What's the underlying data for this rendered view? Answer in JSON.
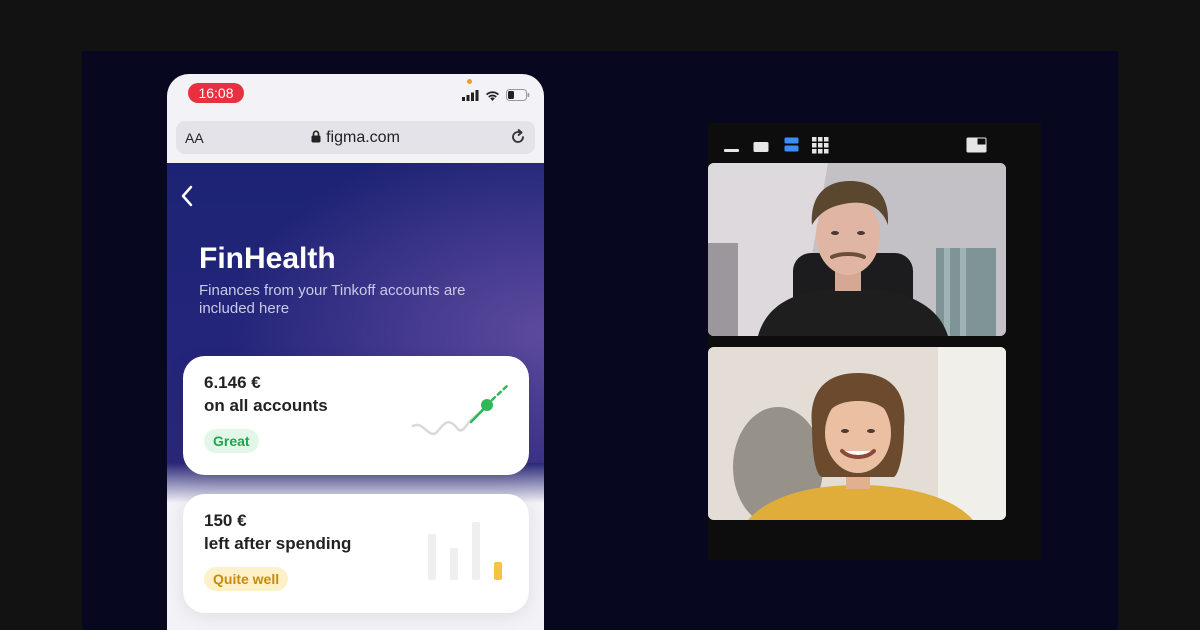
{
  "phone": {
    "status_time": "16:08",
    "url_aa": "AA",
    "url": "figma.com",
    "title": "FinHealth",
    "subtitle": "Finances from your Tinkoff accounts are included here",
    "cards": [
      {
        "amount": "6.146 €",
        "description": "on all accounts",
        "badge": "Great",
        "badge_color": "#1ea64a"
      },
      {
        "amount": "150 €",
        "description": "left after spending",
        "badge": "Quite well",
        "badge_color": "#c98a0a"
      }
    ],
    "accent_red": "#e8303f",
    "accent_green": "#2fb85a",
    "accent_yellow": "#f6c343"
  },
  "video_call": {
    "layout_icons": [
      "minimize-icon",
      "single-view-icon",
      "stacked-view-icon",
      "grid-view-icon",
      "picture-in-picture-icon"
    ],
    "active_layout": "stacked-view-icon",
    "participants": [
      "participant-man",
      "participant-woman"
    ]
  }
}
